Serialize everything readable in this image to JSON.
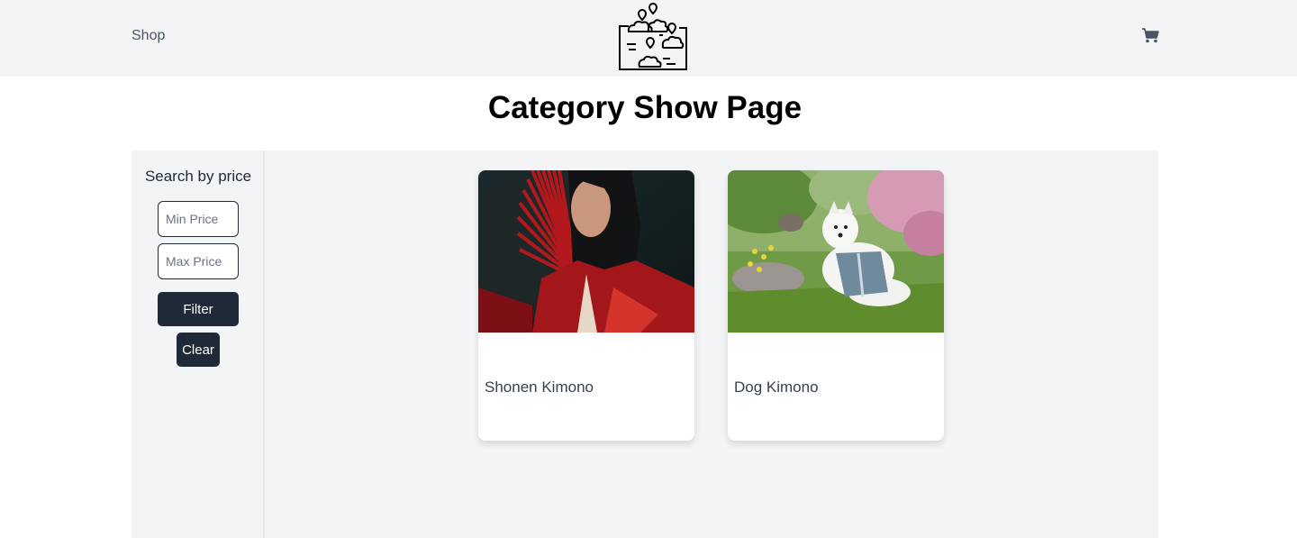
{
  "header": {
    "shop_label": "Shop",
    "logo_icon": "map-clouds-logo-icon",
    "cart_icon": "cart-icon"
  },
  "page": {
    "title": "Category Show Page"
  },
  "sidebar": {
    "title": "Search by price",
    "min_placeholder": "Min Price",
    "max_placeholder": "Max Price",
    "filter_label": "Filter",
    "clear_label": "Clear"
  },
  "products": [
    {
      "name": "Shonen Kimono",
      "image": "woman-red-kimono-umbrella-photo"
    },
    {
      "name": "Dog Kimono",
      "image": "white-dog-kimono-garden-photo"
    }
  ],
  "colors": {
    "header_bg": "#f3f4f6",
    "button_bg": "#1f2937",
    "content_bg": "#f3f4f6"
  }
}
